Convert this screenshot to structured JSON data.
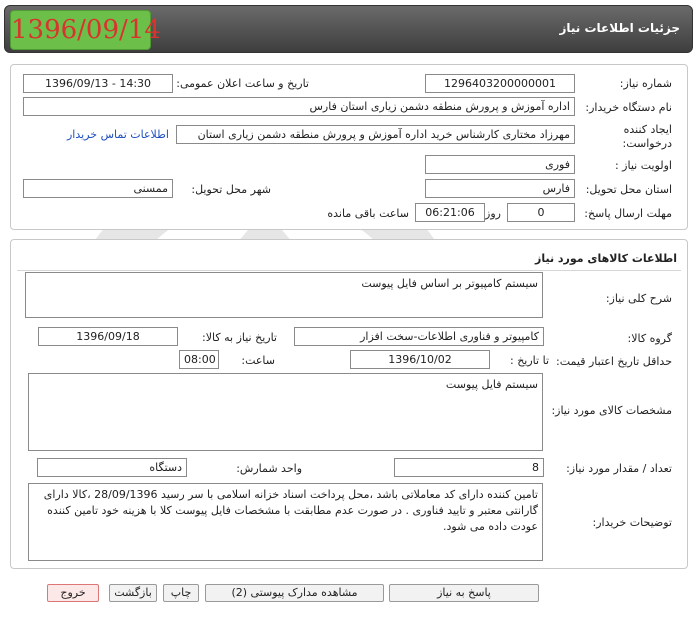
{
  "header": {
    "title": "جزئیات اطلاعات نیاز",
    "date_badge": "1396/09/14"
  },
  "info": {
    "need_number_label": "شماره نیاز:",
    "need_number": "1296403200000001",
    "announce_label": "تاریخ و ساعت اعلان عمومی:",
    "announce_value": "1396/09/13 - 14:30",
    "buyer_org_label": "نام دستگاه خریدار:",
    "buyer_org": "اداره آموزش و پرورش منطقه دشمن زیاری استان فارس",
    "requester_label": "ایجاد کننده درخواست:",
    "requester": "مهرزاد مختاری کارشناس خرید اداره آموزش و پرورش منطقه دشمن زیاری استان",
    "contact_link": "اطلاعات تماس خریدار",
    "priority_label": "اولویت نیاز :",
    "priority": "فوری",
    "province_label": "استان محل تحویل:",
    "province": "فارس",
    "city_label": "شهر محل تحویل:",
    "city": "ممسنی",
    "deadline_label": "مهلت ارسال پاسخ:",
    "deadline_days": "0",
    "days_label": "روز و",
    "deadline_time": "06:21:06",
    "remaining_label": "ساعت باقی مانده"
  },
  "goods": {
    "section_title": "اطلاعات کالاهای مورد نیاز",
    "general_desc_label": "شرح کلی نیاز:",
    "general_desc": "سیستم کامپیوتر بر اساس فایل پیوست",
    "group_label": "گروه کالا:",
    "group": "کامپیوتر و فناوری اطلاعات-سخت افزار",
    "need_date_label": "تاریخ نیاز به کالا:",
    "need_date": "1396/09/18",
    "min_validity_label": "حداقل تاریخ اعتبار قیمت:",
    "to_date_label": "تا تاریخ :",
    "to_date": "1396/10/02",
    "hour_label": "ساعت:",
    "hour": "08:00",
    "specs_label": "مشخصات کالای مورد نیاز:",
    "specs": "سیستم فایل پیوست",
    "quantity_label": "تعداد / مقدار مورد نیاز:",
    "quantity": "8",
    "unit_label": "واحد شمارش:",
    "unit": "دستگاه",
    "buyer_notes_label": "توضیحات خریدار:",
    "buyer_notes": "تامین کننده دارای کد معاملاتی باشد ،محل پرداخت اسناد خزانه اسلامی با سر رسید 28/09/1396 ،کالا دارای گارانتی معتبر و تایید فناوری . در صورت عدم مطابقت با مشخصات فایل پیوست کلا با هزینه خود تامین کننده عودت داده می شود."
  },
  "buttons": {
    "reply": "پاسخ به نیاز",
    "attachments": "مشاهده مدارک پیوستی (2)",
    "print": "چاپ",
    "back": "بازگشت",
    "exit": "خروج"
  },
  "colors": {
    "header_bg": "#4f4f4f",
    "date_badge_bg": "#6cc04a",
    "date_badge_text": "#d8332d",
    "link": "#1f4fbf"
  }
}
